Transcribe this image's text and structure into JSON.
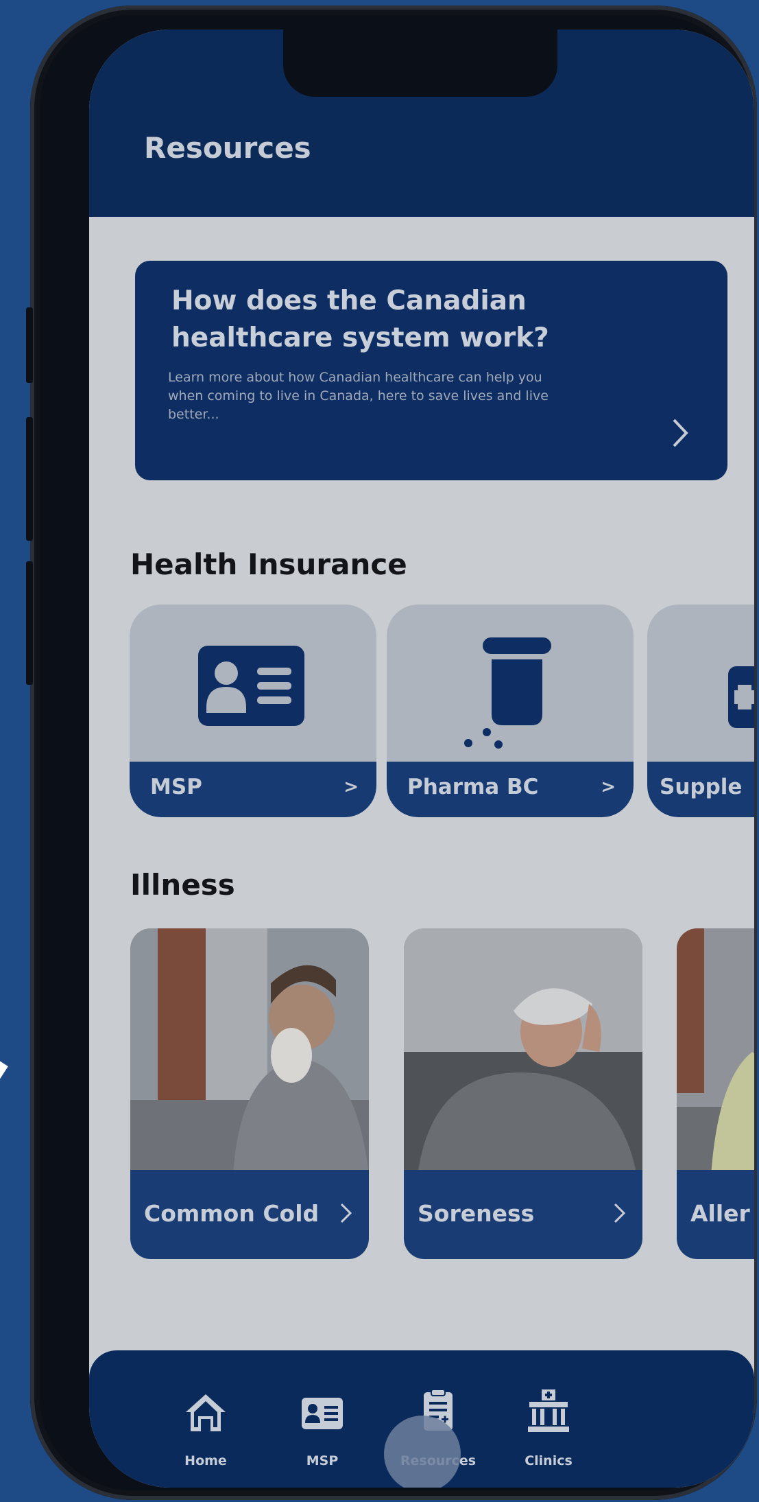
{
  "app": {
    "title": "Resources"
  },
  "info_card": {
    "title": "How does the Canadian healthcare system work?",
    "body": "Learn more about how Canadian healthcare can help you when coming to live in Canada, here to save lives and live better..."
  },
  "health_insurance": {
    "title": "Health Insurance",
    "items": [
      {
        "label": "MSP",
        "arrow": ">",
        "icon": "id-card-icon"
      },
      {
        "label": "Pharma BC",
        "arrow": ">",
        "icon": "pill-bottle-icon"
      },
      {
        "label": "Supple",
        "arrow": ">",
        "icon": "plus-box-icon"
      }
    ]
  },
  "illness": {
    "title": "Illness",
    "items": [
      {
        "label": "Common Cold",
        "image": "man-sneezing-photo"
      },
      {
        "label": "Soreness",
        "image": "woman-headache-photo"
      },
      {
        "label": "Aller",
        "image": "person-on-couch-photo"
      }
    ]
  },
  "bottom_nav": {
    "items": [
      {
        "label": "Home",
        "icon": "home-icon"
      },
      {
        "label": "MSP",
        "icon": "id-card-icon"
      },
      {
        "label": "Resources",
        "icon": "clipboard-icon"
      },
      {
        "label": "Clinics",
        "icon": "hospital-icon"
      }
    ]
  },
  "colors": {
    "background": "#1e4a86",
    "primary": "#0c2a58",
    "card_navy": "#0e2e63",
    "surface": "#c9ccd1"
  }
}
